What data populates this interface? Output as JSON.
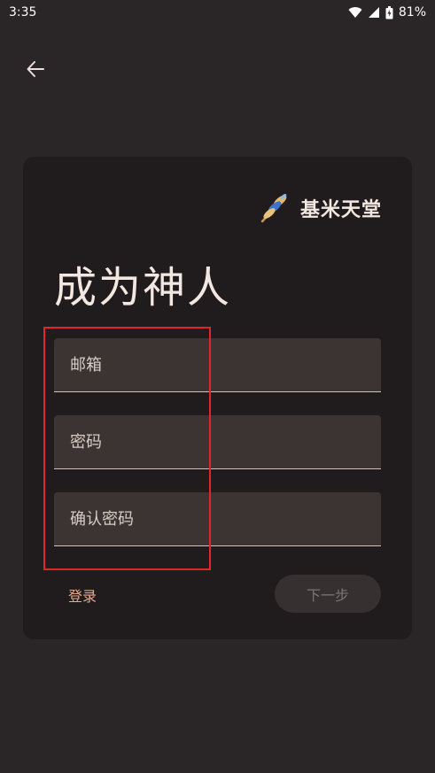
{
  "status_bar": {
    "time": "3:35",
    "battery": "81%"
  },
  "brand": {
    "name": "基米天堂",
    "icon": "skewer-logo-icon"
  },
  "page": {
    "title": "成为神人"
  },
  "form": {
    "email_placeholder": "邮箱",
    "password_placeholder": "密码",
    "confirm_password_placeholder": "确认密码"
  },
  "actions": {
    "login_label": "登录",
    "next_label": "下一步"
  },
  "colors": {
    "accent": "#e8a98c",
    "background": "#2a2527",
    "card": "#201b1c",
    "highlight": "#e0262a"
  }
}
